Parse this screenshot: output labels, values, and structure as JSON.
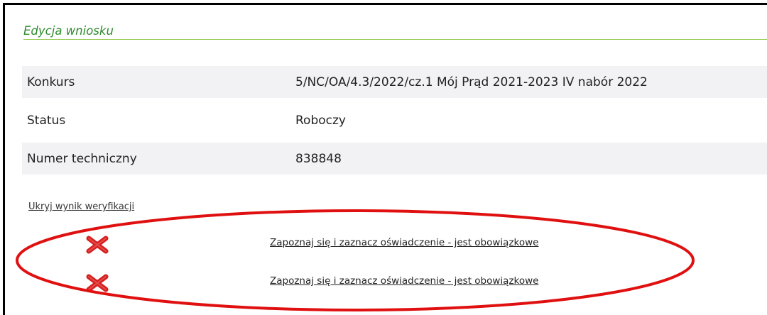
{
  "panel": {
    "title": "Edycja wniosku"
  },
  "info_rows": [
    {
      "label": "Konkurs",
      "value": "5/NC/OA/4.3/2022/cz.1 Mój Prąd 2021-2023 IV nabór 2022"
    },
    {
      "label": "Status",
      "value": "Roboczy"
    },
    {
      "label": "Numer techniczny",
      "value": "838848"
    }
  ],
  "verification": {
    "toggle_label": "Ukryj wynik weryfikacji",
    "errors": [
      {
        "icon": "error-x-icon",
        "message": "Zapoznaj się i zaznacz oświadczenie - jest obowiązkowe"
      },
      {
        "icon": "error-x-icon",
        "message": "Zapoznaj się i zaznacz oświadczenie - jest obowiązkowe"
      }
    ]
  },
  "colors": {
    "title_green": "#2e8b2e",
    "rule_green": "#8cc63f",
    "error_red": "#d62020",
    "annotation_red": "#e01010"
  }
}
